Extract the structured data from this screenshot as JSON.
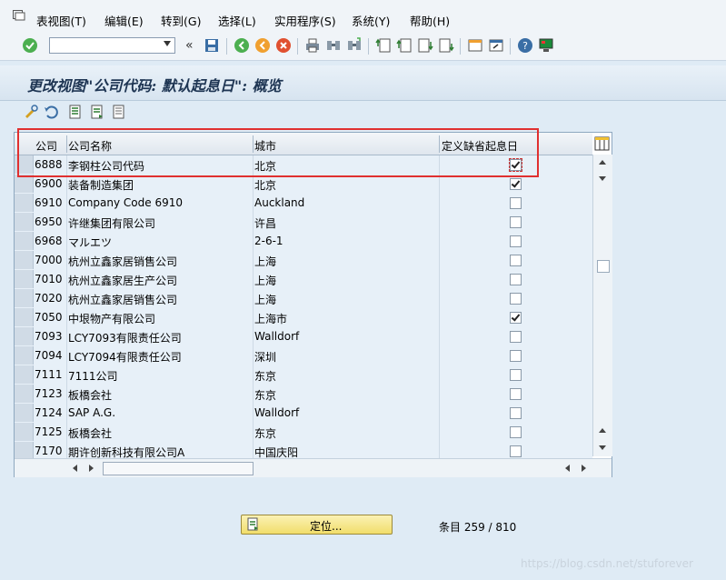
{
  "menu": {
    "items": [
      "表视图(T)",
      "编辑(E)",
      "转到(G)",
      "选择(L)",
      "实用程序(S)",
      "系统(Y)",
      "帮助(H)"
    ]
  },
  "toolbar": {
    "command_field_value": "",
    "icons": [
      "enter-check-icon",
      "dropdown-arrow-icon",
      "collapse-chevron-icon",
      "save-icon",
      "back-icon",
      "exit-icon",
      "cancel-icon",
      "print-icon",
      "find-icon",
      "find-next-icon",
      "first-page-icon",
      "previous-page-icon",
      "next-page-icon",
      "last-page-icon",
      "create-session-icon",
      "shortcut-icon",
      "help-icon",
      "customize-layout-icon"
    ]
  },
  "title": "更改视图\"公司代码: 默认起息日\": 概览",
  "app_toolbar": {
    "icons": [
      "display-change-icon",
      "undo-icon",
      "select-all-icon",
      "select-block-icon",
      "deselect-all-icon"
    ]
  },
  "table": {
    "headers": [
      "公司",
      "公司名称",
      "城市",
      "定义缺省起息日"
    ],
    "rows": [
      {
        "code": "6888",
        "name": "李钢柱公司代码",
        "city": "北京",
        "checked": true
      },
      {
        "code": "6900",
        "name": "装备制造集团",
        "city": "北京",
        "checked": true
      },
      {
        "code": "6910",
        "name": "Company Code 6910",
        "city": "Auckland",
        "checked": false
      },
      {
        "code": "6950",
        "name": "许继集团有限公司",
        "city": "许昌",
        "checked": false
      },
      {
        "code": "6968",
        "name": "マルエツ",
        "city": "2-6-1",
        "checked": false
      },
      {
        "code": "7000",
        "name": "杭州立鑫家居销售公司",
        "city": "上海",
        "checked": false
      },
      {
        "code": "7010",
        "name": "杭州立鑫家居生产公司",
        "city": "上海",
        "checked": false
      },
      {
        "code": "7020",
        "name": "杭州立鑫家居销售公司",
        "city": "上海",
        "checked": false
      },
      {
        "code": "7050",
        "name": "中垠物产有限公司",
        "city": "上海市",
        "checked": true
      },
      {
        "code": "7093",
        "name": "LCY7093有限责任公司",
        "city": "Walldorf",
        "checked": false
      },
      {
        "code": "7094",
        "name": "LCY7094有限责任公司",
        "city": "深圳",
        "checked": false
      },
      {
        "code": "7111",
        "name": "7111公司",
        "city": "东京",
        "checked": false
      },
      {
        "code": "7123",
        "name": "板橋会社",
        "city": "东京",
        "checked": false
      },
      {
        "code": "7124",
        "name": "SAP A.G.",
        "city": "Walldorf",
        "checked": false
      },
      {
        "code": "7125",
        "name": "板橋会社",
        "city": "东京",
        "checked": false
      },
      {
        "code": "7170",
        "name": "期许创新科技有限公司A",
        "city": "中国庆阳",
        "checked": false
      }
    ]
  },
  "position_button": {
    "label": "定位..."
  },
  "entries_text": "条目 259 / 810",
  "watermark": "https://blog.csdn.net/stuforever",
  "colors": {
    "highlight_box": "#e03030",
    "title_text": "#1e3553",
    "button_yellow": "#f1de6b"
  }
}
